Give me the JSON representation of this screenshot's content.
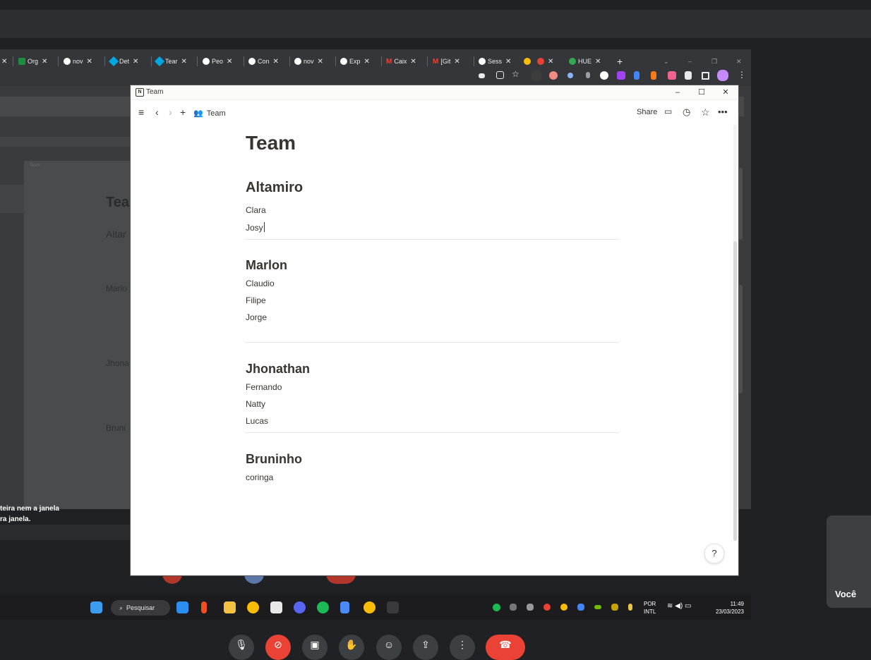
{
  "browser_tabs": [
    {
      "label": "Org",
      "color": "#1e8e3e"
    },
    {
      "label": "nov",
      "color": "#ffffff"
    },
    {
      "label": "Det",
      "color": "#00a7e1"
    },
    {
      "label": "Tear",
      "color": "#00a7e1"
    },
    {
      "label": "Peo",
      "color": "#ffffff"
    },
    {
      "label": "Con",
      "color": "#ffffff"
    },
    {
      "label": "nov",
      "color": "#ffffff"
    },
    {
      "label": "Exp",
      "color": "#ffffff"
    },
    {
      "label": "Caix",
      "color": "#ea4335"
    },
    {
      "label": "[Git",
      "color": "#ea4335"
    },
    {
      "label": "Sess",
      "color": "#ffffff"
    },
    {
      "label": "",
      "color": "#fbbc04"
    },
    {
      "label": "HUE",
      "color": "#34a853"
    }
  ],
  "new_tab_symbol": "+",
  "caption_lines": [
    "teira nem a janela",
    "ra janela."
  ],
  "taskbar": {
    "search_label": "Pesquisar",
    "lang_line1": "POR",
    "lang_line2": "INTL",
    "time": "11:49",
    "date": "23/03/2023"
  },
  "participant": {
    "label": "Você"
  },
  "notion": {
    "window_title": "Team",
    "breadcrumb": "Team",
    "share_label": "Share",
    "page_title": "Team",
    "sections": [
      {
        "heading": "Altamiro",
        "members": [
          "Clara",
          "Josy"
        ]
      },
      {
        "heading": "Marlon",
        "members": [
          "Claudio",
          "Filipe",
          "Jorge"
        ]
      },
      {
        "heading": "Jhonathan",
        "members": [
          "Fernando",
          "Natty",
          "Lucas"
        ]
      },
      {
        "heading": "Bruninho",
        "members": [
          "coringa"
        ]
      }
    ],
    "help_label": "?"
  },
  "ghost": {
    "title": "Tea",
    "h1": "Altar",
    "h2": "Marlo",
    "h3": "Jhona",
    "h4": "Bruni",
    "tab_title": "Team"
  },
  "colors": {
    "accent_red": "#ea4335",
    "meet_bg": "#202124"
  }
}
